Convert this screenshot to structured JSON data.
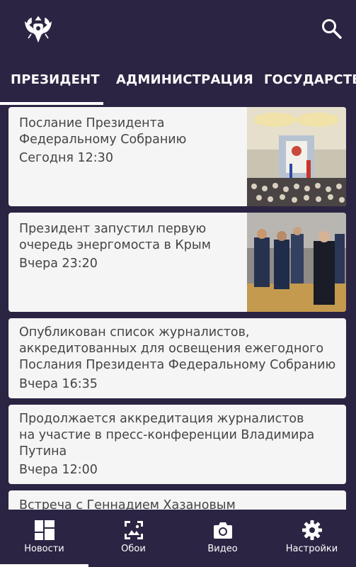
{
  "tabs": [
    {
      "label": "ПРЕЗИДЕНТ"
    },
    {
      "label": "АДМИНИСТРАЦИЯ"
    },
    {
      "label": "ГОСУДАРСТВЕ"
    }
  ],
  "news": [
    {
      "title_lines": [
        "Послание Президента",
        "Федеральному Собранию"
      ],
      "time": "Сегодня 12:30"
    },
    {
      "title_lines": [
        "Президент запустил первую",
        "очередь энергомоста в Крым"
      ],
      "time": "Вчера 23:20"
    },
    {
      "title_lines": [
        "Опубликован список журналистов,",
        "аккредитованных для освещения ежегодного",
        "Послания Президента Федеральному Собранию"
      ],
      "time": "Вчера 16:35"
    },
    {
      "title_lines": [
        "Продолжается аккредитация журналистов",
        "на участие в пресс-конференции Владимира",
        "Путина"
      ],
      "time": "Вчера 12:00"
    },
    {
      "title_lines": [
        "Встреча с Геннадием Хазановым"
      ],
      "time": ""
    }
  ],
  "bottom_nav": [
    {
      "label": "Новости",
      "icon": "dashboard-icon"
    },
    {
      "label": "Обои",
      "icon": "wallpaper-icon"
    },
    {
      "label": "Видео",
      "icon": "camera-icon"
    },
    {
      "label": "Настройки",
      "icon": "settings-gear-icon"
    }
  ],
  "colors": {
    "background": "#2c2443",
    "card": "#f5f5f5",
    "text": "#444444",
    "indicator": "#ffffff"
  }
}
